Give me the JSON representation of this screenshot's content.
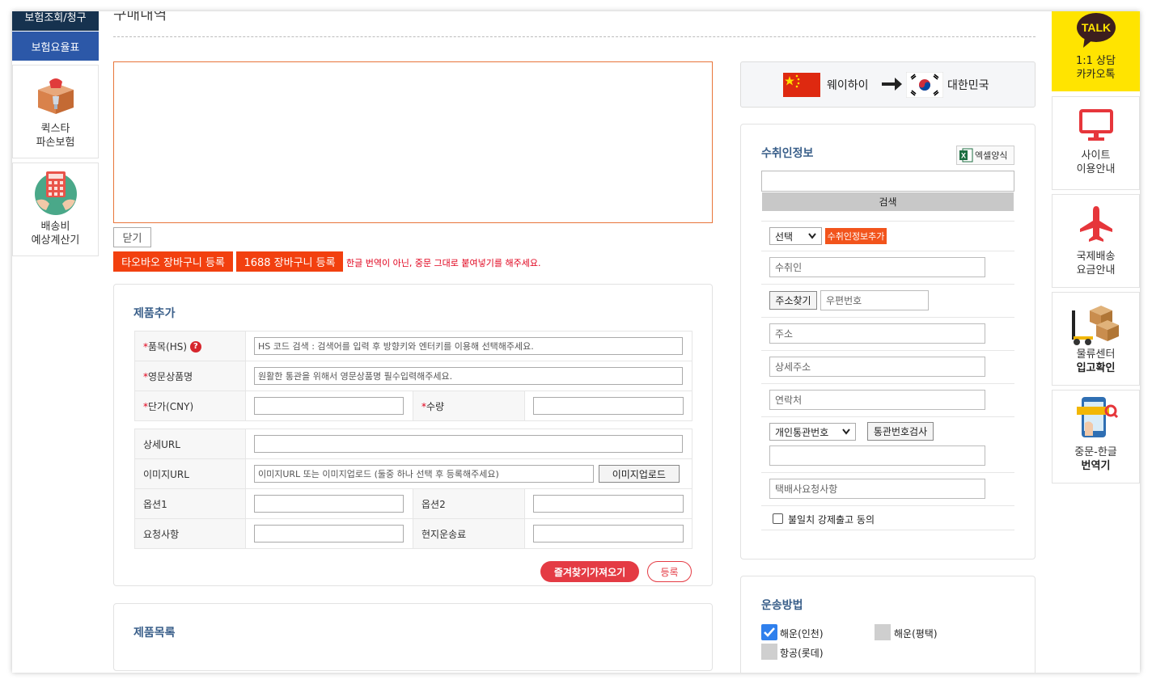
{
  "left_sidebar": {
    "top_button": "보험조회/청구",
    "rate_button": "보험요율표",
    "insurance": {
      "line1": "퀵스타",
      "line2": "파손보험"
    },
    "calculator": {
      "line1": "배송비",
      "line2": "예상계산기"
    }
  },
  "right_sidebar": {
    "talk_badge": "TALK",
    "kakao": {
      "line1": "1:1 상담",
      "line2": "카카오톡"
    },
    "site": {
      "line1": "사이트",
      "line2": "이용안내"
    },
    "rates": {
      "line1": "국제배송",
      "line2": "요금안내"
    },
    "logistics": {
      "line1": "물류센터",
      "line2": "입고확인"
    },
    "translator": {
      "line1": "중문-한글",
      "line2": "번역기"
    }
  },
  "page_title": "구매내역",
  "close_label": "닫기",
  "basket_buttons": {
    "taobao": "타오바오 장바구니 등록",
    "b1688": "1688 장바구니 등록"
  },
  "notice": "한글 번역이 아닌, 중문 그대로 붙여넣기를 해주세요.",
  "product_add": {
    "title": "제품추가",
    "required_mark": "*",
    "hs_label": "품목(HS)",
    "hs_help": "?",
    "hs_placeholder": "HS 코드 검색 : 검색어를 입력 후 방향키와 엔터키를 이용해 선택해주세요.",
    "en_name_label": "영문상품명",
    "en_name_placeholder": "원활한 통관을 위해서 영문상품명 필수입력해주세요.",
    "price_label": "단가(CNY)",
    "qty_label": "수량",
    "detail_url_label": "상세URL",
    "image_url_label": "이미지URL",
    "image_url_placeholder": "이미지URL 또는 이미지업로드 (둘중 하나 선택 후 등록해주세요)",
    "image_upload_button": "이미지업로드",
    "option1_label": "옵션1",
    "option2_label": "옵션2",
    "request_label": "요청사항",
    "local_shipping_label": "현지운송료",
    "favorites_button": "즐겨찾기가져오기",
    "register_button": "등록"
  },
  "product_list": {
    "title": "제품목록"
  },
  "route": {
    "from": "웨이하이",
    "to": "대한민국"
  },
  "recipient": {
    "title": "수취인정보",
    "excel_label": "엑셀양식",
    "search_button": "검색",
    "select_value": "선택",
    "add_button": "수취인정보추가",
    "name_placeholder": "수취인",
    "address_search_button": "주소찾기",
    "postcode_placeholder": "우편번호",
    "address_placeholder": "주소",
    "address_detail_placeholder": "상세주소",
    "phone_placeholder": "연락처",
    "customs_select": "개인통관번호",
    "customs_check_button": "통관번호검사",
    "delivery_request_placeholder": "택배사요청사항",
    "agree_label": "불일치 강제출고 동의"
  },
  "shipping": {
    "title": "운송방법",
    "options": [
      "해운(인천)",
      "해운(평택)",
      "항공(롯데)"
    ]
  },
  "colors": {
    "navy": "#16324f",
    "blue": "#2c58a8",
    "orange": "#f2400f",
    "kakao": "#ffe400",
    "link_blue": "#3a5f8a"
  }
}
